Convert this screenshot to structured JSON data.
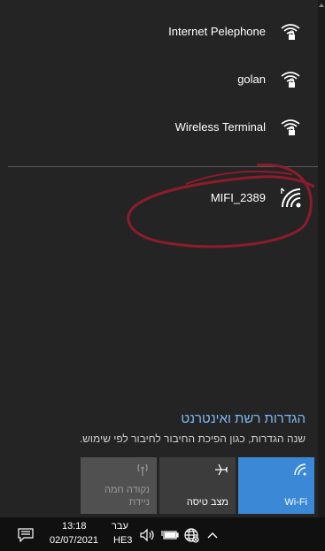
{
  "networks": [
    {
      "name": "Internet Pelephone"
    },
    {
      "name": "golan"
    },
    {
      "name": "Wireless Terminal"
    },
    {
      "name": "MIFI_2389"
    }
  ],
  "settings": {
    "title": "הגדרות רשת ואינטרנט",
    "description": "שנה הגדרות, כגון הפיכת החיבור לחיבור לפי שימוש."
  },
  "tiles": {
    "wifi": {
      "label": "Wi-Fi",
      "color": "#3b89d6"
    },
    "airplane": {
      "label": "מצב טיסה",
      "color": "#3c3c3c"
    },
    "hotspot": {
      "label_1": "נקודה חמה",
      "label_2": "ניידת",
      "color": "#505050"
    }
  },
  "taskbar": {
    "time": "13:18",
    "date": "02/07/2021",
    "lang_top": "עבר",
    "lang_bottom": "HE3"
  },
  "colors": {
    "accent": "#3b89d6",
    "annotation": "#8c1c2c"
  }
}
